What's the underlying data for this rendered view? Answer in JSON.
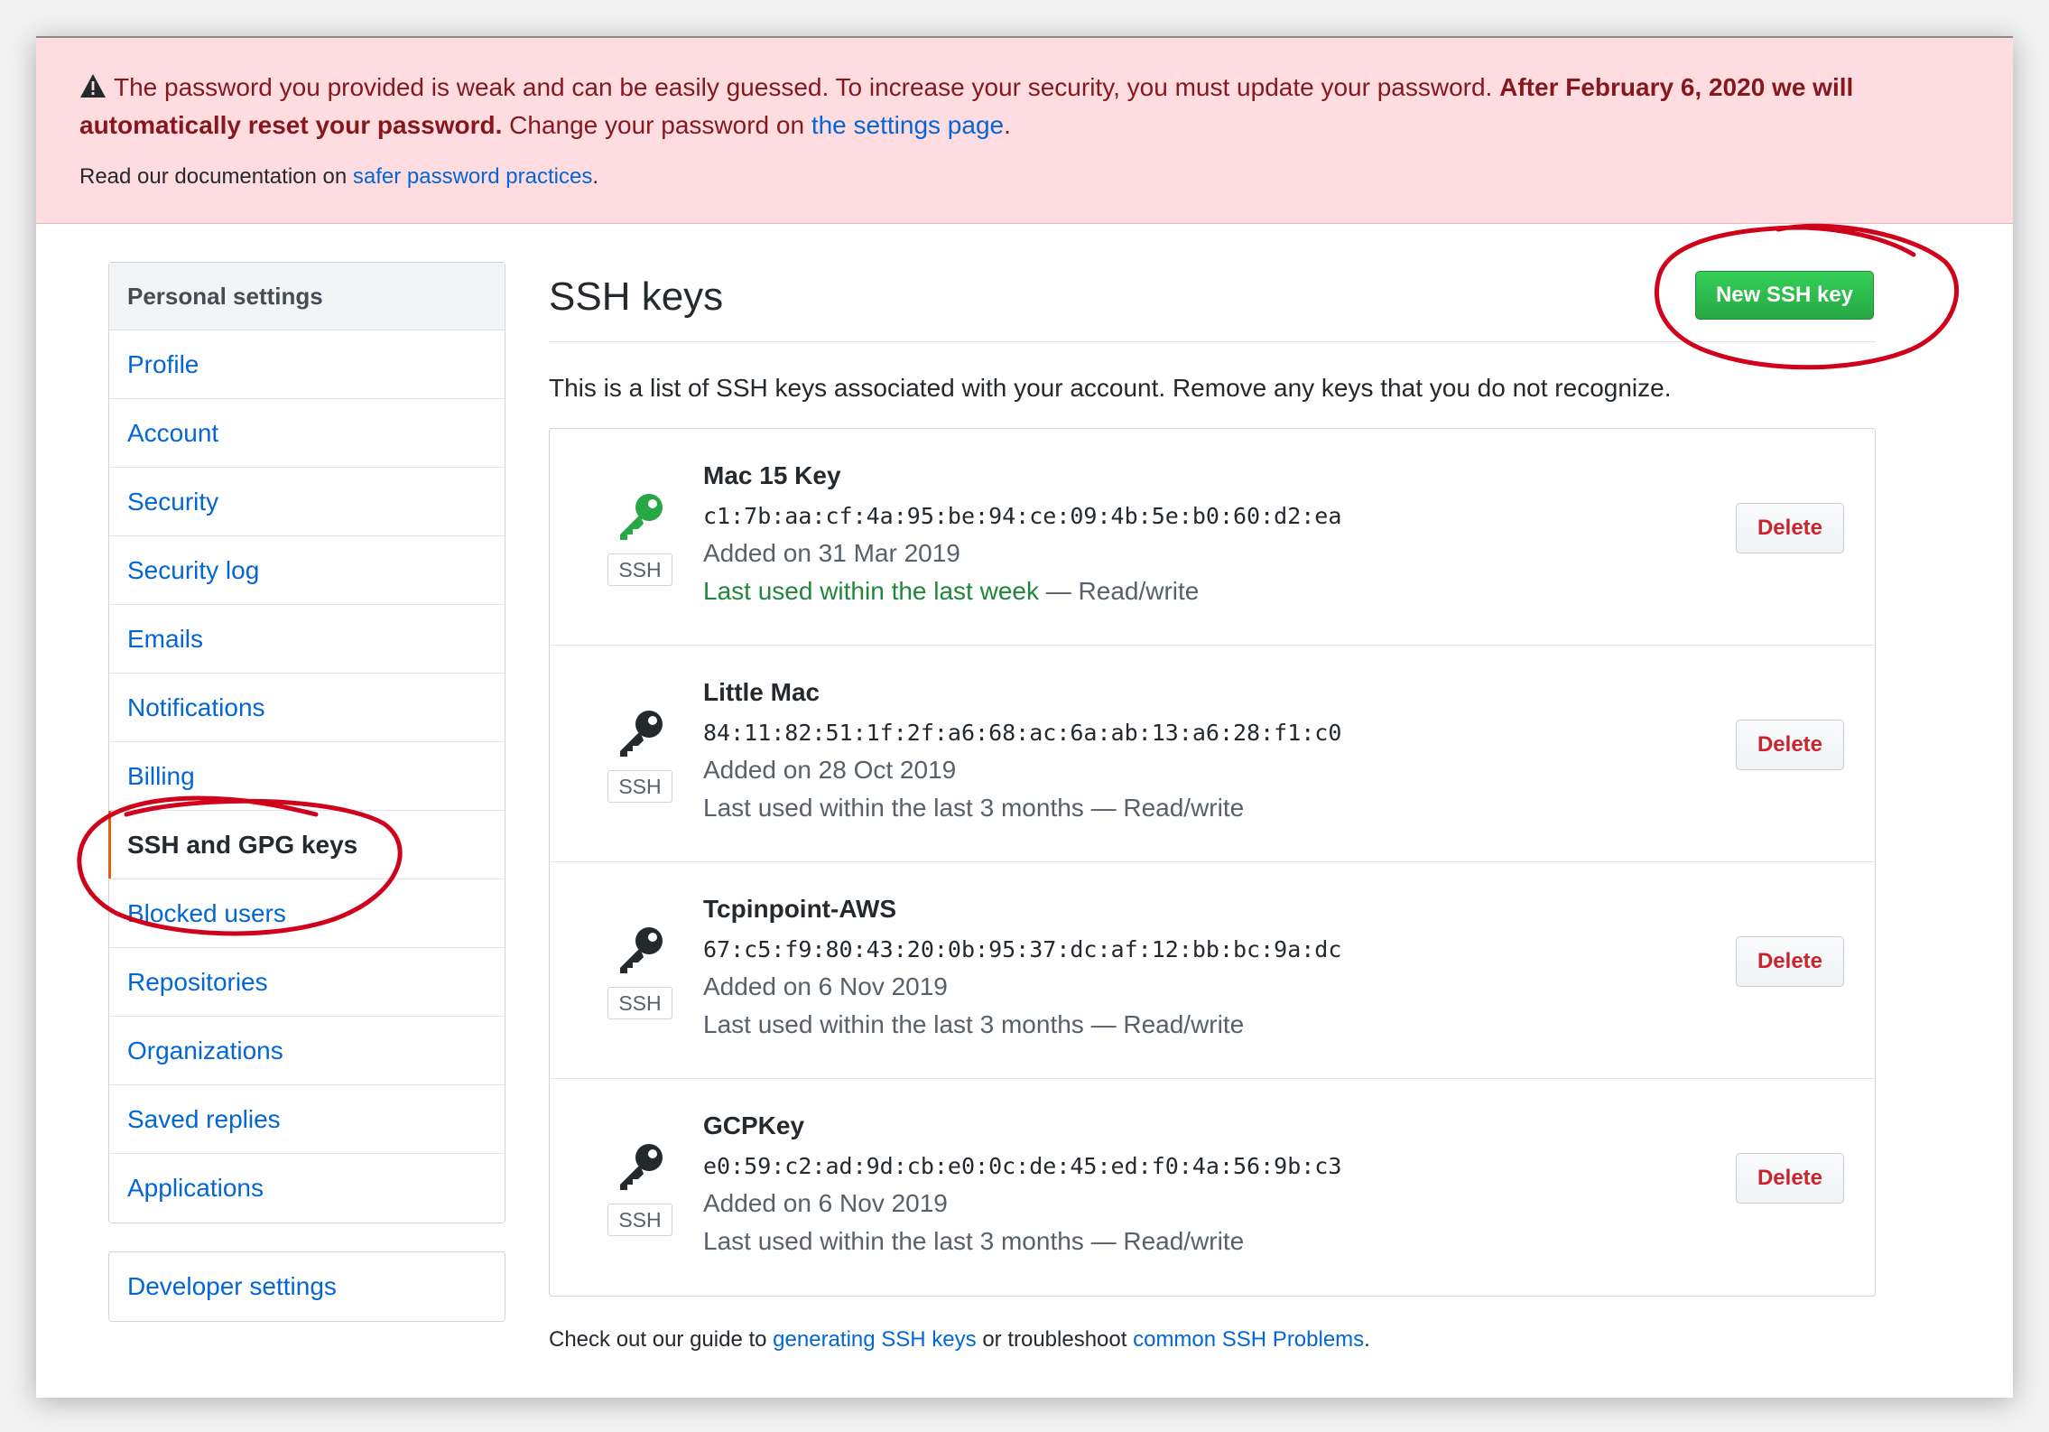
{
  "flash": {
    "line1_text": "The password you provided is weak and can be easily guessed. To increase your security, you must update your password.",
    "line1_bold": "After February 6, 2020 we will automatically reset your password.",
    "line2_text": "Change your password on",
    "settings_link": "the settings page",
    "doc_text": "Read our documentation on",
    "doc_link": "safer password practices"
  },
  "sidebar": {
    "heading": "Personal settings",
    "items": [
      {
        "label": "Profile"
      },
      {
        "label": "Account"
      },
      {
        "label": "Security"
      },
      {
        "label": "Security log"
      },
      {
        "label": "Emails"
      },
      {
        "label": "Notifications"
      },
      {
        "label": "Billing"
      },
      {
        "label": "SSH and GPG keys",
        "selected": true
      },
      {
        "label": "Blocked users"
      },
      {
        "label": "Repositories"
      },
      {
        "label": "Organizations"
      },
      {
        "label": "Saved replies"
      },
      {
        "label": "Applications"
      }
    ],
    "developer_settings": "Developer settings"
  },
  "main": {
    "title": "SSH keys",
    "new_button": "New SSH key",
    "description": "This is a list of SSH keys associated with your account. Remove any keys that you do not recognize.",
    "keys": [
      {
        "name": "Mac 15 Key",
        "fingerprint": "c1:7b:aa:cf:4a:95:be:94:ce:09:4b:5e:b0:60:d2:ea",
        "added": "Added on 31 Mar 2019",
        "used": "Last used within the last week",
        "access": "— Read/write",
        "badge": "SSH",
        "delete": "Delete",
        "icon": "key-icon",
        "icon_color": "#28a745"
      },
      {
        "name": "Little Mac",
        "fingerprint": "84:11:82:51:1f:2f:a6:68:ac:6a:ab:13:a6:28:f1:c0",
        "added": "Added on 28 Oct 2019",
        "used": "Last used within the last 3 months",
        "access": "— Read/write",
        "badge": "SSH",
        "delete": "Delete",
        "icon": "key-icon",
        "icon_color": "#24292e"
      },
      {
        "name": "Tcpinpoint-AWS",
        "fingerprint": "67:c5:f9:80:43:20:0b:95:37:dc:af:12:bb:bc:9a:dc",
        "added": "Added on 6 Nov 2019",
        "used": "Last used within the last 3 months",
        "access": "— Read/write",
        "badge": "SSH",
        "delete": "Delete",
        "icon": "key-icon",
        "icon_color": "#24292e"
      },
      {
        "name": "GCPKey",
        "fingerprint": "e0:59:c2:ad:9d:cb:e0:0c:de:45:ed:f0:4a:56:9b:c3",
        "added": "Added on 6 Nov 2019",
        "used": "Last used within the last 3 months",
        "access": "— Read/write",
        "badge": "SSH",
        "delete": "Delete",
        "icon": "key-icon",
        "icon_color": "#24292e"
      }
    ],
    "footer": {
      "prefix": "Check out our guide to",
      "link1": "generating SSH keys",
      "middle": "or troubleshoot",
      "link2": "common SSH Problems",
      "suffix": "."
    }
  },
  "colors": {
    "flash_bg": "#ffdce0",
    "link": "#0366d6",
    "primary_button": "#28a745",
    "danger_text": "#cb2431",
    "selected_accent": "#e36209",
    "annotation": "#d0021b"
  }
}
